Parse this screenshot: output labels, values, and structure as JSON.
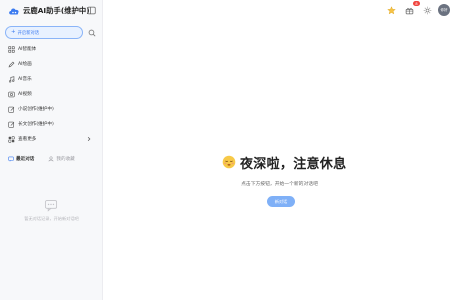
{
  "app": {
    "title": "云鹿AI助手(维护中)"
  },
  "sidebar": {
    "new_chat_label": "开启新对话",
    "items": [
      {
        "label": "AI智能体",
        "icon": "grid-icon"
      },
      {
        "label": "AI绘画",
        "icon": "pen-icon"
      },
      {
        "label": "AI音乐",
        "icon": "music-icon"
      },
      {
        "label": "AI视频",
        "icon": "video-icon"
      },
      {
        "label": "小说创作(维护中)",
        "icon": "edit-doc-icon"
      },
      {
        "label": "长文创作(维护中)",
        "icon": "edit-doc-icon"
      },
      {
        "label": "查看更多",
        "icon": "apps-icon"
      }
    ],
    "tabs": [
      {
        "label": "最近对话",
        "active": true
      },
      {
        "label": "我的收藏",
        "active": false
      }
    ],
    "empty_text": "暂无对话记录，开始新对话吧"
  },
  "topbar": {
    "notification_count": "8",
    "avatar_text": "你好"
  },
  "main": {
    "welcome_title": "夜深啦，注意休息",
    "subtitle": "点击下方按钮，开始一个新的对话吧",
    "start_button": "新对话"
  },
  "colors": {
    "accent": "#3a7af0",
    "accent_light": "#e8f1ff",
    "button": "#7fb0f7",
    "badge": "#f0443e"
  }
}
